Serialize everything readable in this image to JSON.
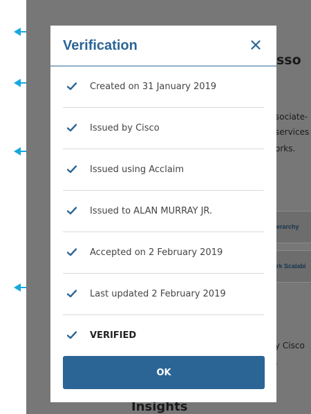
{
  "background": {
    "title_fragment": "sso",
    "text_lines": [
      "sociate-",
      "services",
      "orks."
    ],
    "row_labels": [
      "erarchy",
      "rk Scalabi"
    ],
    "text_lines_lower": [
      "y Cisco",
      "."
    ],
    "section_heading": "Insights"
  },
  "modal": {
    "title": "Verification",
    "close_label": "×",
    "items": [
      {
        "label": "Created on 31 January 2019"
      },
      {
        "label": "Issued by Cisco"
      },
      {
        "label": "Issued using Acclaim"
      },
      {
        "label": "Issued to ALAN MURRAY JR."
      },
      {
        "label": "Accepted on 2 February 2019"
      },
      {
        "label": "Last updated 2 February 2019"
      },
      {
        "label": "VERIFIED"
      }
    ],
    "ok_label": "OK"
  },
  "colors": {
    "accent": "#2b6595",
    "arrow": "#18a8e0",
    "overlay": "#777777"
  }
}
